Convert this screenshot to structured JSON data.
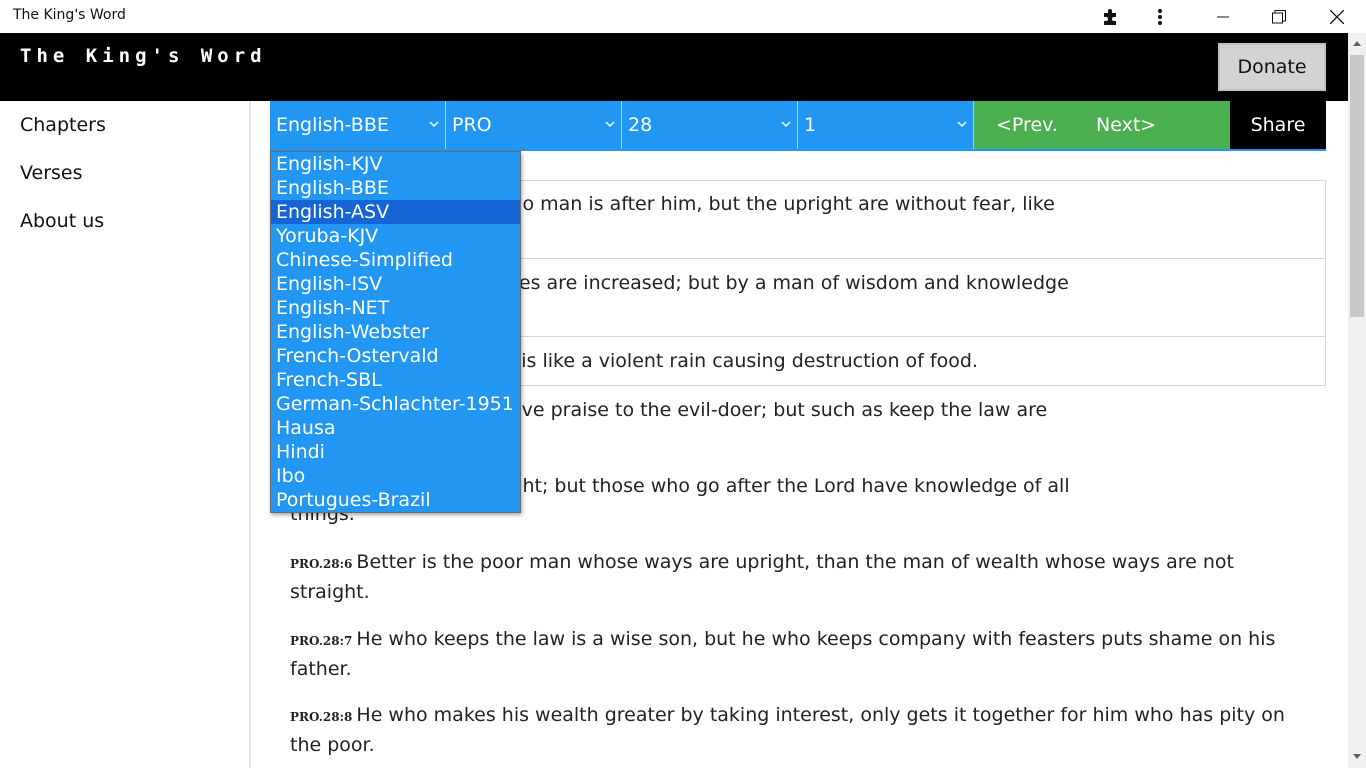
{
  "window": {
    "title": "The King's Word",
    "controls": [
      "extensions-icon",
      "more-icon",
      "minimize-icon",
      "maximize-icon",
      "close-icon"
    ]
  },
  "header": {
    "title": "The King's Word",
    "donate_label": "Donate"
  },
  "sidebar": {
    "items": [
      {
        "label": "Chapters"
      },
      {
        "label": "Verses"
      },
      {
        "label": "About us"
      }
    ]
  },
  "toolbar": {
    "version": "English-BBE",
    "book": "PRO",
    "chapter": "28",
    "verse": "1",
    "prev_label": "<Prev.",
    "next_label": "Next>",
    "share_label": "Share"
  },
  "dropdown": {
    "options": [
      "English-KJV",
      "English-BBE",
      "English-ASV",
      "Yoruba-KJV",
      "Chinese-Simplified",
      "English-ISV",
      "English-NET",
      "English-Webster",
      "French-Ostervald",
      "French-SBL",
      "German-Schlachter-1951",
      "Hausa",
      "Hindi",
      "Ibo",
      "Portugues-Brazil"
    ],
    "highlighted": "English-ASV"
  },
  "verses": [
    {
      "line1": "es running away when no man is after him, but the upright are without fear, like",
      "line2": ""
    },
    {
      "line1": "on of the land, its troubles are increased; but by a man of wisdom and knowledge",
      "line2": "a fire."
    },
    {
      "line1": "who is cruel to the poor is like a violent rain causing destruction of food.",
      "line2": ""
    },
    {
      "line1": "no respect for the law give praise to the evil-doer; but such as keep the law are",
      "line2": ""
    },
    {
      "line1": "knowledge of what is right; but those who go after the Lord have knowledge of all",
      "line2": "things."
    },
    {
      "ref": "PRO.28:6",
      "line1": "Better is the poor man whose ways are upright, than the man of wealth whose ways are not",
      "line2": "straight."
    },
    {
      "ref": "PRO.28:7",
      "line1": "He who keeps the law is a wise son, but he who keeps company with feasters puts shame on his",
      "line2": "father."
    },
    {
      "ref": "PRO.28:8",
      "line1": "He who makes his wealth greater by taking interest, only gets it together for him who has pity on",
      "line2": "the poor."
    }
  ],
  "colors": {
    "accent_blue": "#2196f3",
    "highlight_blue": "#1565d6",
    "nav_green": "#4caf50",
    "header_black": "#000000"
  }
}
